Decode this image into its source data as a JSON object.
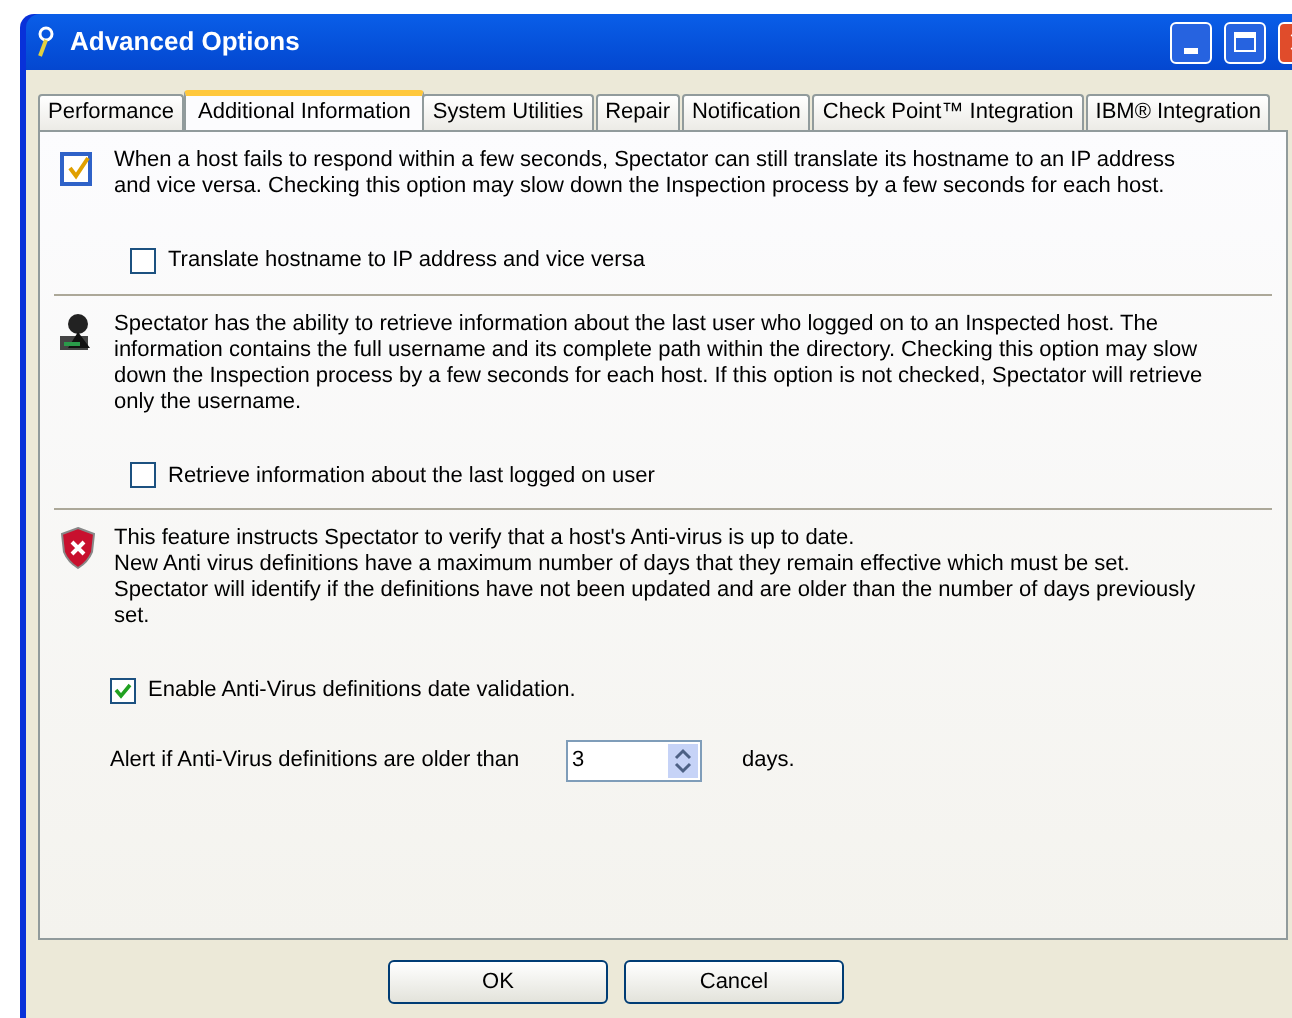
{
  "window": {
    "title": "Advanced Options"
  },
  "tabs": [
    {
      "label": "Performance",
      "selected": false
    },
    {
      "label": "Additional Information",
      "selected": true
    },
    {
      "label": "System Utilities",
      "selected": false
    },
    {
      "label": "Repair",
      "selected": false
    },
    {
      "label": "Notification",
      "selected": false
    },
    {
      "label": "Check Point™ Integration",
      "selected": false
    },
    {
      "label": "IBM® Integration",
      "selected": false
    }
  ],
  "sections": [
    {
      "kind": "checklist",
      "description": "When a host fails to respond within a few seconds, Spectator can still translate its hostname to an IP address and vice versa. Checking this option may slow down the Inspection process by a few seconds for each host.",
      "checkbox": {
        "label": "Translate hostname to IP address and vice versa",
        "checked": false
      }
    },
    {
      "kind": "user",
      "description": "Spectator has the ability to retrieve information about the last user who logged on to an Inspected host. The information contains the full username and its complete path within the directory. Checking this option may slow down the Inspection process by a few seconds for each host. If this option is not checked, Spectator will retrieve only the username.",
      "checkbox": {
        "label": "Retrieve information about the last logged on user",
        "checked": false
      }
    },
    {
      "kind": "shield",
      "description": "This feature instructs Spectator to verify that a host's Anti-virus is up to date.\nNew Anti virus definitions have a maximum number of days that they remain effective which must be set.\nSpectator will identify if the definitions have not been updated and are older than the number of days previously set.",
      "checkbox": {
        "label": "Enable Anti-Virus definitions date validation.",
        "checked": true
      },
      "alert": {
        "label": "Alert if Anti-Virus definitions are older than",
        "value": "3",
        "unit": "days."
      }
    }
  ],
  "buttons": [
    "OK",
    "Cancel"
  ]
}
